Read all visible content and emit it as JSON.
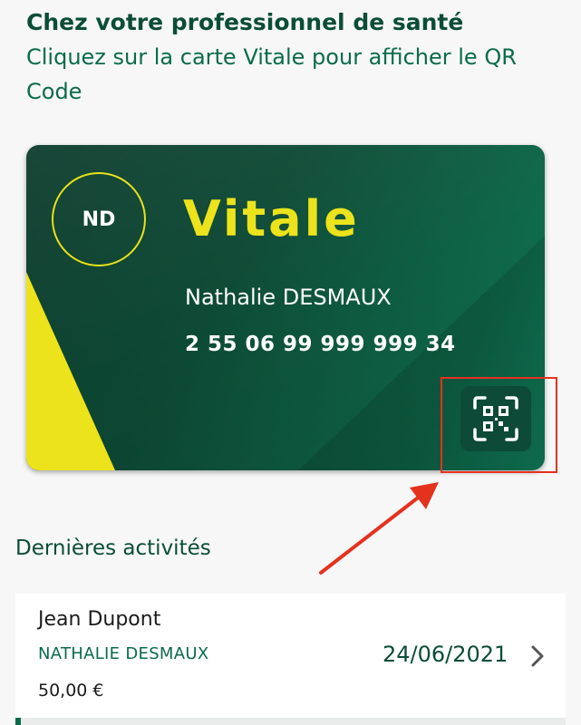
{
  "header": {
    "title": "Chez votre professionnel de santé",
    "subtitle": "Cliquez sur la carte Vitale pour afficher le QR Code"
  },
  "card": {
    "initials": "ND",
    "brand": "Vitale",
    "holder_name": "Nathalie DESMAUX",
    "number": "2 55 06 99 999 999 34",
    "qr_icon": "qr-code-icon",
    "colors": {
      "card_dark": "#0b3a2b",
      "card_light": "#128f67",
      "accent_yellow": "#ece31c"
    }
  },
  "annotation": {
    "highlight_color": "#e4321f"
  },
  "activities": {
    "title": "Dernières activités",
    "items": [
      {
        "name": "Jean Dupont",
        "patient": "NATHALIE DESMAUX",
        "amount": "50,00 €",
        "date": "24/06/2021",
        "icon": "chevron-right-icon"
      }
    ]
  }
}
